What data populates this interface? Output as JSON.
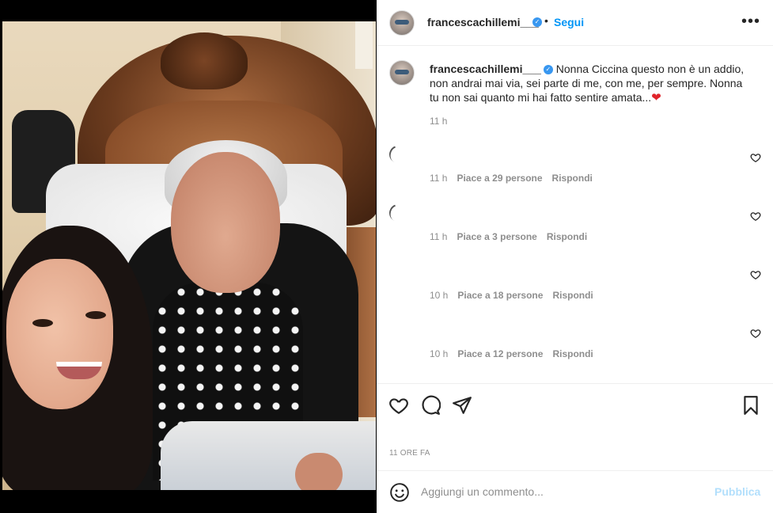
{
  "post": {
    "username": "francescachillemi___",
    "verified_icon": "verified-badge-icon",
    "separator": "•",
    "follow_label": "Segui",
    "more_icon": "more-options-icon",
    "more_label": "•••"
  },
  "caption": {
    "username": "francescachillemi___",
    "text": "Nonna Ciccina questo non è un addio, non andrai mai via, sei parte di me, con me, per sempre. Nonna tu non sai quanto mi hai fatto sentire amata...",
    "emoji": "❤",
    "time": "11 h"
  },
  "comments": [
    {
      "time": "11 h",
      "likes": "Piace a 29 persone",
      "reply": "Rispondi"
    },
    {
      "time": "11 h",
      "likes": "Piace a 3 persone",
      "reply": "Rispondi"
    },
    {
      "time": "10 h",
      "likes": "Piace a 18 persone",
      "reply": "Rispondi"
    },
    {
      "time": "10 h",
      "likes": "Piace a 12 persone",
      "reply": "Rispondi"
    }
  ],
  "actions": {
    "icons": [
      "like-icon",
      "comment-icon",
      "share-icon",
      "save-icon"
    ],
    "time_ago": "11 ORE FA"
  },
  "comment_box": {
    "placeholder": "Aggiungi un commento...",
    "publish_label": "Pubblica",
    "emoji_icon": "emoji-icon"
  },
  "colors": {
    "accent": "#0095f6",
    "verified": "#3897f0",
    "muted": "#8e8e8e",
    "publish_disabled": "#b2dffc",
    "heart": "#e0242b"
  }
}
